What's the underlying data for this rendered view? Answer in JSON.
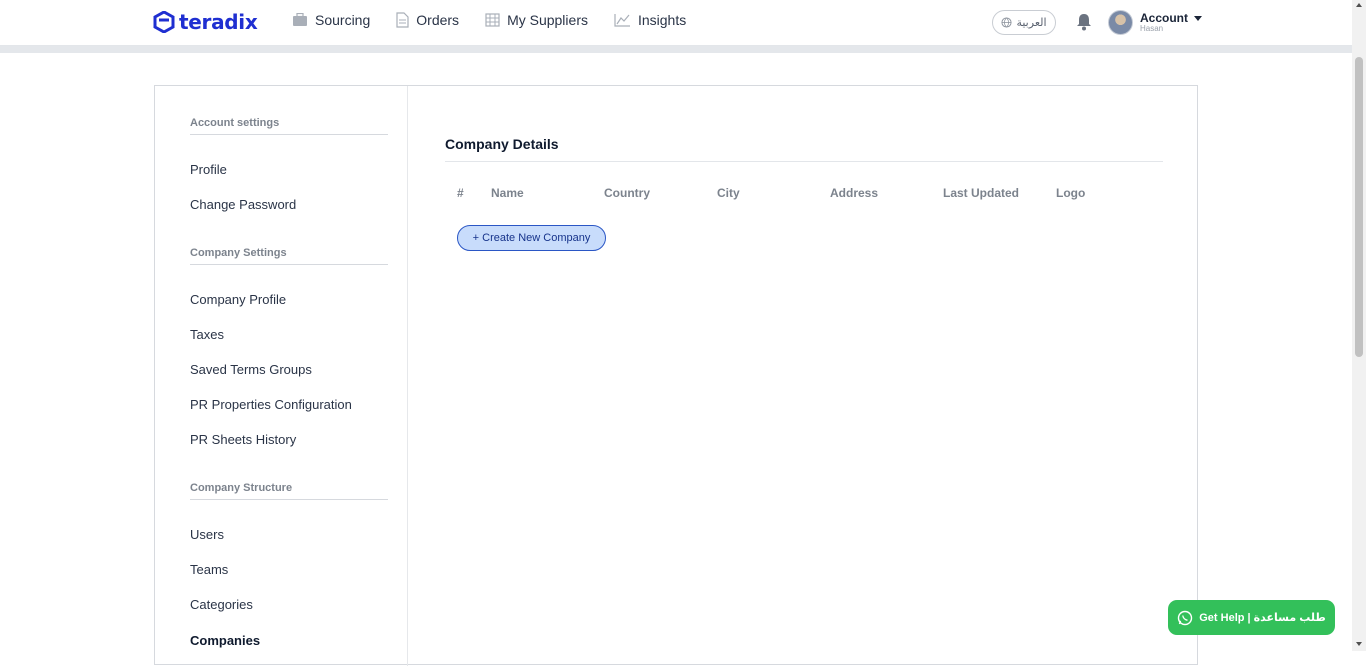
{
  "brand": {
    "name": "teradix"
  },
  "nav": {
    "items": [
      {
        "label": "Sourcing",
        "icon": "briefcase-icon"
      },
      {
        "label": "Orders",
        "icon": "document-icon"
      },
      {
        "label": "My Suppliers",
        "icon": "building-icon"
      },
      {
        "label": "Insights",
        "icon": "chart-icon"
      }
    ],
    "language": "العربية",
    "account_label": "Account",
    "account_user": "Hasan"
  },
  "sidebar": {
    "account_settings": {
      "title": "Account settings",
      "items": [
        "Profile",
        "Change Password"
      ]
    },
    "company_settings": {
      "title": "Company Settings",
      "items": [
        "Company Profile",
        "Taxes",
        "Saved Terms Groups",
        "PR Properties Configuration",
        "PR Sheets History"
      ]
    },
    "company_structure": {
      "title": "Company Structure",
      "items": [
        "Users",
        "Teams",
        "Categories",
        "Companies"
      ],
      "active": "Companies"
    }
  },
  "main": {
    "title": "Company Details",
    "columns": [
      "#",
      "Name",
      "Country",
      "City",
      "Address",
      "Last Updated",
      "Logo"
    ],
    "create_button": "+ Create New Company"
  },
  "help_button": "Get Help | طلب مساعدة",
  "colors": {
    "brand": "#1f2fd1",
    "help_green": "#33c05a",
    "button_bg": "#c8dcfb"
  }
}
